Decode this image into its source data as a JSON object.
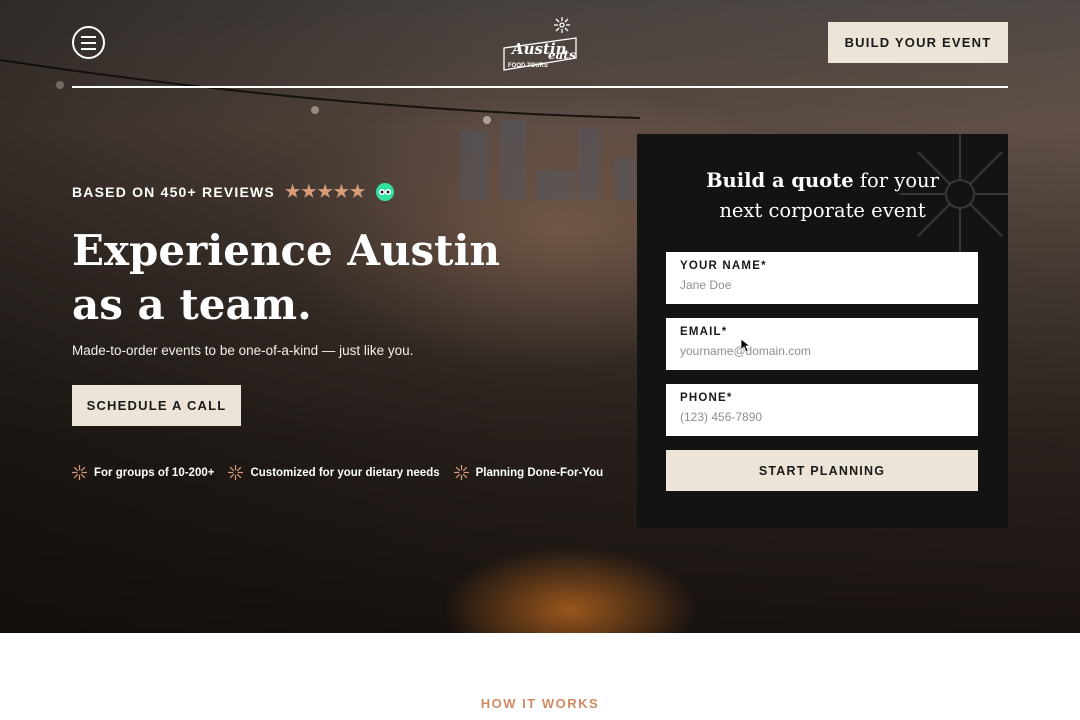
{
  "header": {
    "logo_text_line1": "Austin",
    "logo_text_line2": "eats",
    "logo_text_line3": "FOOD TOURS",
    "build_button": "BUILD YOUR EVENT"
  },
  "hero": {
    "reviews_label": "BASED ON 450+ REVIEWS",
    "stars": "★★★★★",
    "headline_line1": "Experience Austin",
    "headline_line2": "as a team.",
    "subheading": "Made-to-order events to be one-of-a-kind — just like you.",
    "schedule_button": "SCHEDULE A CALL",
    "features": [
      "For groups of 10-200+",
      "Customized for your dietary needs",
      "Planning Done-For-You"
    ]
  },
  "form": {
    "title_bold": "Build a quote",
    "title_rest_line1": " for your",
    "title_line2": "next corporate event",
    "name_label": "YOUR NAME*",
    "name_placeholder": "Jane Doe",
    "email_label": "EMAIL*",
    "email_placeholder": "yourname@domain.com",
    "phone_label": "PHONE*",
    "phone_placeholder": "(123) 456-7890",
    "submit_button": "START PLANNING"
  },
  "section": {
    "how_it_works": "HOW IT WORKS"
  },
  "colors": {
    "button_bg": "#ece4d6",
    "panel_bg": "#141313",
    "star_color": "#d79b7b",
    "accent_orange": "#d08a63",
    "tripadvisor_green": "#34e0a1"
  }
}
